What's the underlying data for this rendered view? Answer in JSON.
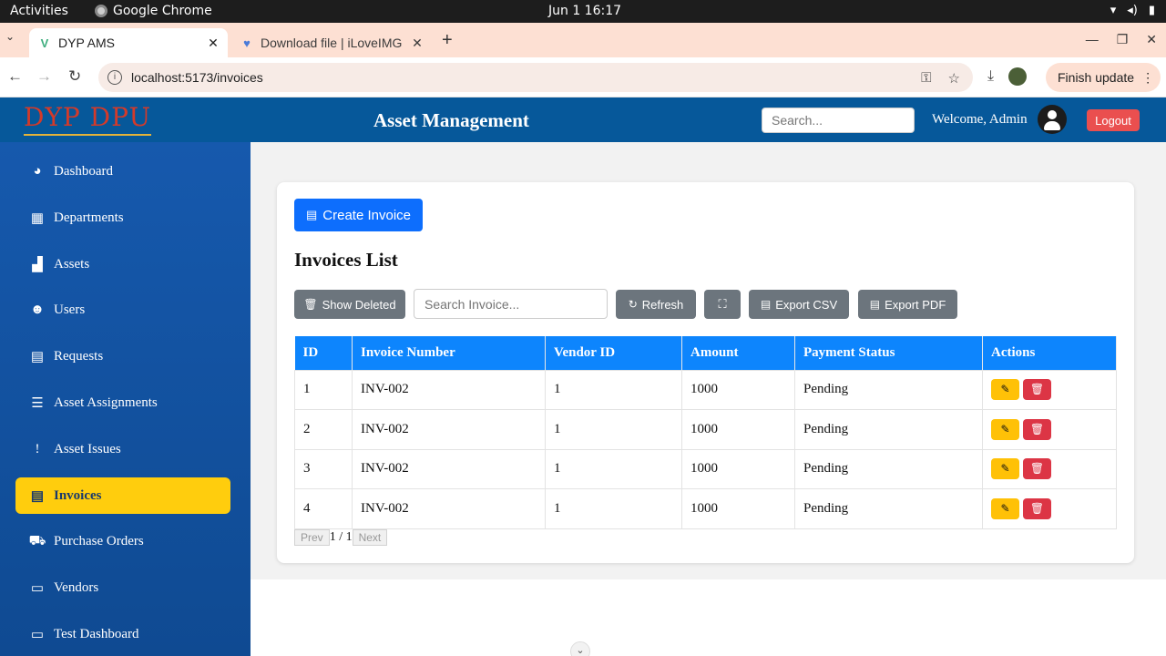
{
  "os": {
    "activities": "Activities",
    "app_name": "Google Chrome",
    "clock": "Jun 1  16:17",
    "tray": [
      "▾",
      "◂)",
      "▮"
    ]
  },
  "browser": {
    "tabs": [
      {
        "title": "DYP AMS",
        "icon": "vue-icon"
      },
      {
        "title": "Download file | iLoveIMG",
        "icon": "ilovepdf-icon"
      }
    ],
    "url": "localhost:5173/invoices",
    "finish_update": "Finish update"
  },
  "header": {
    "logo": "DYP DPU",
    "title": "Asset Management",
    "search_placeholder": "Search...",
    "welcome": "Welcome, Admin",
    "logout": "Logout"
  },
  "sidebar": {
    "items": [
      {
        "label": "Dashboard",
        "icon": "dashboard-icon",
        "glyph": "◕"
      },
      {
        "label": "Departments",
        "icon": "building-icon",
        "glyph": "▦"
      },
      {
        "label": "Assets",
        "icon": "boxes-icon",
        "glyph": "▟"
      },
      {
        "label": "Users",
        "icon": "users-icon",
        "glyph": "☻"
      },
      {
        "label": "Requests",
        "icon": "file-icon",
        "glyph": "▤"
      },
      {
        "label": "Asset Assignments",
        "icon": "list-check-icon",
        "glyph": "☰"
      },
      {
        "label": "Asset Issues",
        "icon": "exclamation-icon",
        "glyph": "!"
      },
      {
        "label": "Invoices",
        "icon": "invoice-icon",
        "glyph": "▤",
        "active": true
      },
      {
        "label": "Purchase Orders",
        "icon": "cart-icon",
        "glyph": "⛟"
      },
      {
        "label": "Vendors",
        "icon": "store-icon",
        "glyph": "▭"
      },
      {
        "label": "Test Dashboard",
        "icon": "store-icon",
        "glyph": "▭"
      }
    ]
  },
  "main": {
    "create_button": "Create Invoice",
    "list_title": "Invoices List",
    "toolbar": {
      "show_deleted": "Show Deleted",
      "search_placeholder": "Search Invoice...",
      "refresh": "Refresh",
      "export_csv": "Export CSV",
      "export_pdf": "Export PDF"
    },
    "table": {
      "columns": [
        "ID",
        "Invoice Number",
        "Vendor ID",
        "Amount",
        "Payment Status",
        "Actions"
      ],
      "rows": [
        {
          "id": "1",
          "number": "INV-002",
          "vendor": "1",
          "amount": "1000",
          "status": "Pending"
        },
        {
          "id": "2",
          "number": "INV-002",
          "vendor": "1",
          "amount": "1000",
          "status": "Pending"
        },
        {
          "id": "3",
          "number": "INV-002",
          "vendor": "1",
          "amount": "1000",
          "status": "Pending"
        },
        {
          "id": "4",
          "number": "INV-002",
          "vendor": "1",
          "amount": "1000",
          "status": "Pending"
        }
      ]
    },
    "pagination": {
      "prev": "Prev",
      "current": "1 / 1",
      "next": "Next"
    }
  },
  "colors": {
    "header_bg": "#06589a",
    "sidebar_bg": "#1659ad",
    "active_item": "#ffcd0d",
    "primary": "#0d6efd",
    "table_header": "#0d85fd",
    "edit": "#ffc107",
    "delete": "#dc3545",
    "logout": "#ea4f4f"
  }
}
